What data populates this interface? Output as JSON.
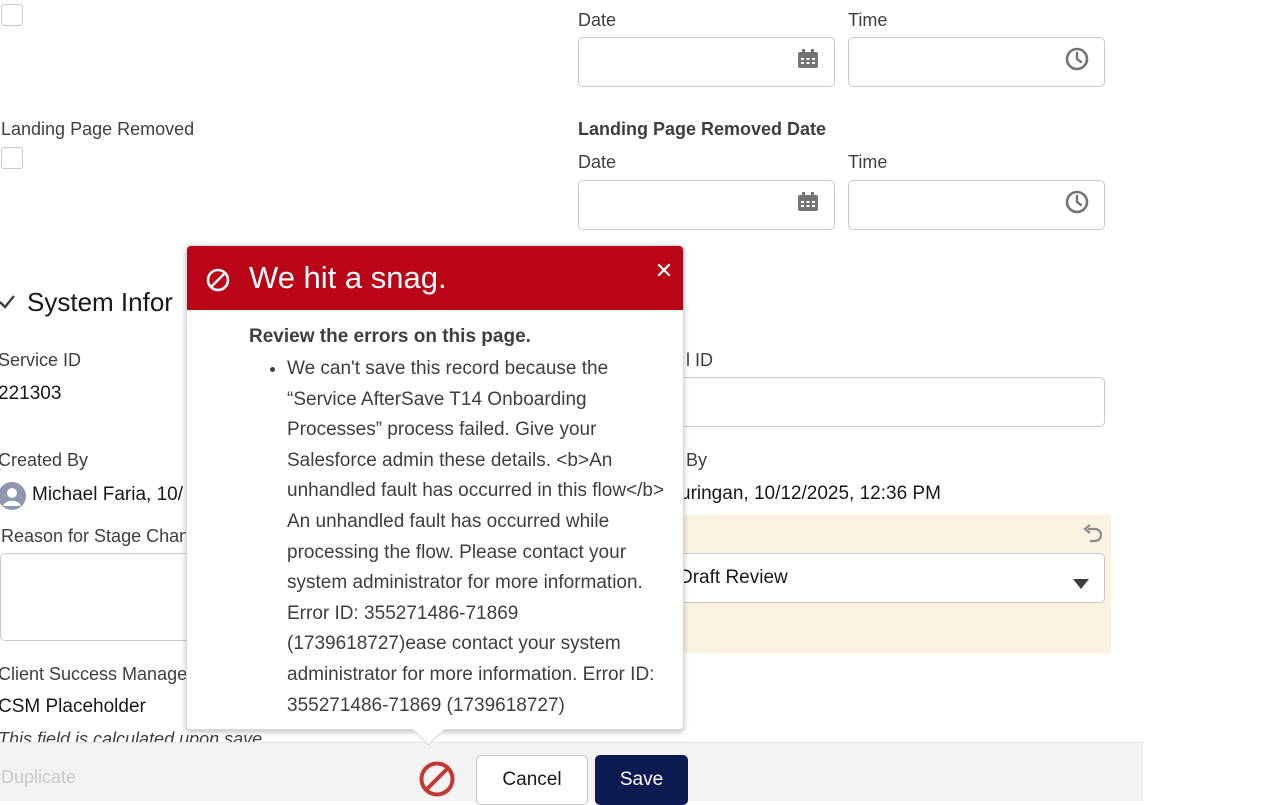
{
  "top_section": {
    "date_label": "Date",
    "time_label": "Time"
  },
  "landing_page": {
    "checkbox_label": "Landing Page Removed",
    "date_group_title": "Landing Page Removed Date",
    "date_label": "Date",
    "time_label": "Time"
  },
  "system_info": {
    "section_title": "System Infor",
    "service_id_label": "Service ID",
    "service_id_value": "221303",
    "right_id_label": "l ID",
    "created_by_label": "Created By",
    "created_by_value": "Michael Faria, 10/",
    "modified_by_label": "By",
    "modified_by_value": "uringan, 10/12/2025, 12:36 PM",
    "reason_label": "Reason for Stage Chan",
    "stage_value": "Draft Review",
    "csm_label": "Client Success Manager",
    "csm_value": "CSM Placeholder",
    "csm_help": "This field is calculated upon save",
    "duplicate_label": "Duplicate"
  },
  "error_popover": {
    "title": "We hit a snag.",
    "heading": "Review the errors on this page.",
    "message": "We can't save this record because the “Service AfterSave T14 Onboarding Processes” process failed. Give your Salesforce admin these details. <b>An unhandled fault has occurred in this flow</b> An unhandled fault has occurred while processing the flow. Please contact your system administrator for more information. Error ID: 355271486-71869 (1739618727)ease contact your system administrator for more information. Error ID: 355271486-71869 (1739618727)",
    "accent_color": "#ba0517"
  },
  "footer": {
    "cancel_label": "Cancel",
    "save_label": "Save"
  },
  "icons": {
    "calendar": "calendar-icon",
    "clock": "clock-icon",
    "error": "error-icon",
    "close": "close-icon",
    "undo": "undo-icon",
    "dropdown": "chevron-down-icon",
    "avatar": "avatar-icon",
    "check": "check-icon"
  }
}
